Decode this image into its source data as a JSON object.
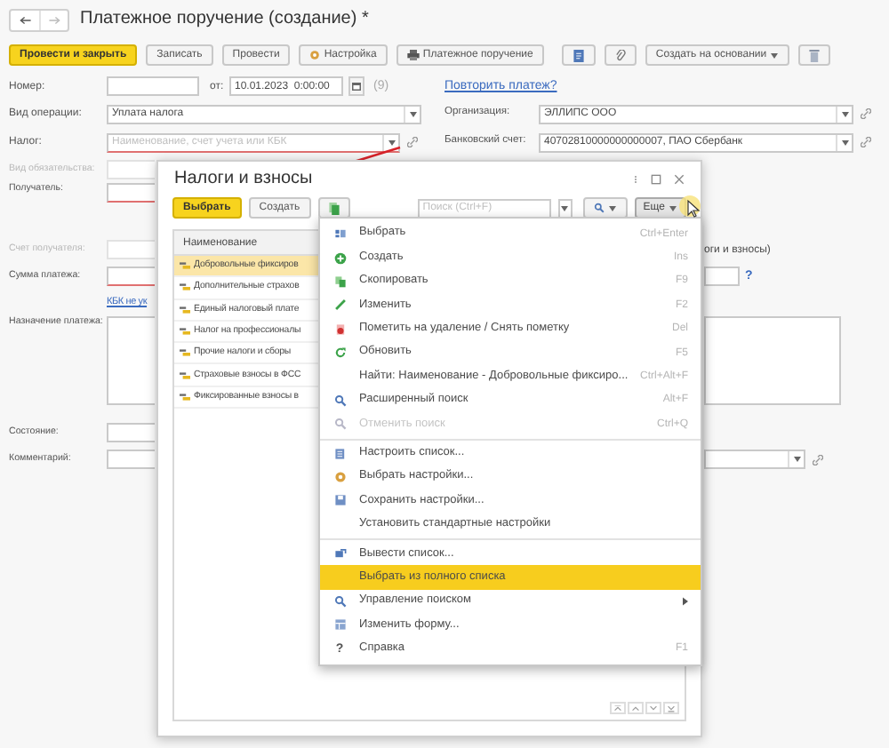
{
  "window": {
    "title": "Платежное поручение (создание) *"
  },
  "toolbar": [
    {
      "kind": "button",
      "label": "Провести и закрыть",
      "default": true,
      "dropdown": false
    },
    {
      "kind": "button",
      "label": "Записать",
      "default": false,
      "dropdown": false
    },
    {
      "kind": "button",
      "label": "Провести",
      "default": false,
      "dropdown": false
    },
    {
      "kind": "button",
      "label": "Настройка",
      "default": false,
      "dropdown": false
    },
    {
      "kind": "button",
      "label": "Платежное поручение",
      "default": false,
      "dropdown": false
    },
    {
      "kind": "icon_button",
      "default": false,
      "dropdown": false
    },
    {
      "kind": "icon_button",
      "default": false,
      "dropdown": false
    },
    {
      "kind": "button",
      "label": "Создать на основании",
      "default": false,
      "dropdown": true
    },
    {
      "kind": "icon_button",
      "default": false,
      "dropdown": false
    }
  ],
  "form": {
    "number": {
      "label": "Номер:"
    },
    "date": {
      "label": "от:",
      "value": "10.01.2023  0:00:00",
      "counter": "(9)"
    },
    "repeat_link": "Повторить платеж?",
    "operation_type": {
      "label": "Вид операции:",
      "value": "Уплата налога"
    },
    "organization": {
      "label": "Организация:",
      "value": "ЭЛЛИПС ООО"
    },
    "tax": {
      "label": "Налог:",
      "placeholder": "Наименование, счет учета или КБК",
      "required": true
    },
    "bank_account": {
      "label": "Банковский счет:",
      "value": "40702810000000000007, ПАО Сбербанк"
    },
    "left_rows": [
      {
        "kind": "field",
        "label": "Вид обязательства:",
        "disabled": true,
        "required": false
      },
      {
        "kind": "field",
        "label": "Получатель:",
        "disabled": false,
        "required": true
      },
      {
        "kind": "field",
        "label": "Счет получателя:",
        "disabled": true,
        "required": false
      },
      {
        "kind": "field",
        "label": "Сумма платежа:",
        "disabled": false,
        "required": true
      },
      {
        "kind": "link",
        "label": "КБК не ук"
      },
      {
        "kind": "textarea",
        "label": "Назначение платежа:",
        "disabled": false,
        "required": false
      },
      {
        "kind": "field",
        "label": "Состояние:",
        "disabled": false,
        "required": false
      },
      {
        "kind": "field",
        "label": "Комментарий:",
        "disabled": false,
        "required": false
      }
    ],
    "right_text": "оги и взносы)",
    "help": "?"
  },
  "dialog": {
    "title": "Налоги и взносы",
    "buttons": [
      {
        "label": "Выбрать",
        "default": true
      },
      {
        "label": "Создать",
        "default": false
      }
    ],
    "search": {
      "placeholder": "Поиск (Ctrl+F)"
    },
    "more_button": "Еще",
    "columns": [
      "Наименование"
    ],
    "rows": [
      {
        "name": "Добровольные фиксиров",
        "selected": true
      },
      {
        "name": "Дополнительные страхов",
        "selected": false
      },
      {
        "name": "Единый налоговый плате",
        "selected": false
      },
      {
        "name": "Налог на профессионалы",
        "selected": false
      },
      {
        "name": "Прочие налоги и сборы",
        "selected": false
      },
      {
        "name": "Страховые взносы в ФСС",
        "selected": false
      },
      {
        "name": "Фиксированные взносы в",
        "selected": false
      }
    ]
  },
  "menu": [
    {
      "kind": "item",
      "label": "Выбрать",
      "shortcut": "Ctrl+Enter",
      "disabled": false,
      "selected": false,
      "submenu": false
    },
    {
      "kind": "item",
      "label": "Создать",
      "shortcut": "Ins",
      "disabled": false,
      "selected": false,
      "submenu": false
    },
    {
      "kind": "item",
      "label": "Скопировать",
      "shortcut": "F9",
      "disabled": false,
      "selected": false,
      "submenu": false
    },
    {
      "kind": "item",
      "label": "Изменить",
      "shortcut": "F2",
      "disabled": false,
      "selected": false,
      "submenu": false
    },
    {
      "kind": "item",
      "label": "Пометить на удаление / Снять пометку",
      "shortcut": "Del",
      "disabled": false,
      "selected": false,
      "submenu": false
    },
    {
      "kind": "item",
      "label": "Обновить",
      "shortcut": "F5",
      "disabled": false,
      "selected": false,
      "submenu": false
    },
    {
      "kind": "item",
      "label": "Найти: Наименование - Добровольные фиксиро...",
      "shortcut": "Ctrl+Alt+F",
      "disabled": false,
      "selected": false,
      "submenu": false
    },
    {
      "kind": "item",
      "label": "Расширенный поиск",
      "shortcut": "Alt+F",
      "disabled": false,
      "selected": false,
      "submenu": false
    },
    {
      "kind": "item",
      "label": "Отменить поиск",
      "shortcut": "Ctrl+Q",
      "disabled": true,
      "selected": false,
      "submenu": false
    },
    {
      "kind": "separator"
    },
    {
      "kind": "item",
      "label": "Настроить список...",
      "disabled": false,
      "selected": false,
      "submenu": false
    },
    {
      "kind": "item",
      "label": "Выбрать настройки...",
      "disabled": false,
      "selected": false,
      "submenu": false
    },
    {
      "kind": "item",
      "label": "Сохранить настройки...",
      "disabled": false,
      "selected": false,
      "submenu": false
    },
    {
      "kind": "item",
      "label": "Установить стандартные настройки",
      "disabled": false,
      "selected": false,
      "submenu": false
    },
    {
      "kind": "separator"
    },
    {
      "kind": "item",
      "label": "Вывести список...",
      "disabled": false,
      "selected": false,
      "submenu": false
    },
    {
      "kind": "item",
      "label": "Выбрать из полного списка",
      "disabled": false,
      "selected": true,
      "submenu": false
    },
    {
      "kind": "item",
      "label": "Управление поиском",
      "disabled": false,
      "selected": false,
      "submenu": true
    },
    {
      "kind": "item",
      "label": "Изменить форму...",
      "disabled": false,
      "selected": false,
      "submenu": false
    },
    {
      "kind": "item",
      "glyph": "?",
      "label": "Справка",
      "shortcut": "F1",
      "disabled": false,
      "selected": false,
      "submenu": false
    }
  ]
}
